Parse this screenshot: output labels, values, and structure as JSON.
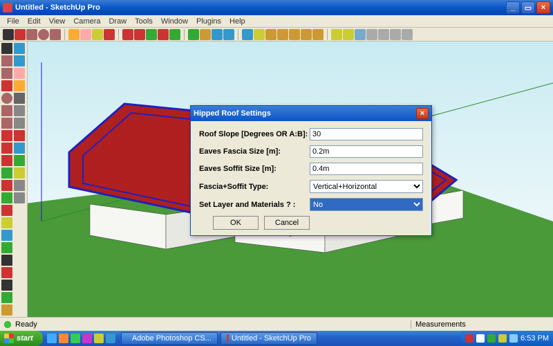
{
  "window": {
    "title": "Untitled - SketchUp Pro"
  },
  "menu": [
    "File",
    "Edit",
    "View",
    "Camera",
    "Draw",
    "Tools",
    "Window",
    "Plugins",
    "Help"
  ],
  "dialog": {
    "title": "Hipped Roof Settings",
    "fields": {
      "slope_label": "Roof Slope [Degrees OR A:B]:",
      "slope_value": "30",
      "fascia_label": "Eaves Fascia Size [m]:",
      "fascia_value": "0.2m",
      "soffit_label": "Eaves Soffit Size [m]:",
      "soffit_value": "0.4m",
      "type_label": "Fascia+Soffit Type:",
      "type_value": "Vertical+Horizontal",
      "layer_label": "Set Layer and Materials ? :",
      "layer_value": "No"
    },
    "ok": "OK",
    "cancel": "Cancel"
  },
  "status": {
    "ready": "Ready",
    "measurements_label": "Measurements"
  },
  "taskbar": {
    "start": "start",
    "items": [
      {
        "label": "Adobe Photoshop CS...",
        "color": "#2a4a8a"
      },
      {
        "label": "Untitled - SketchUp Pro",
        "color": "#c04030"
      }
    ],
    "clock": "6:53 PM"
  },
  "colors": {
    "roof": "#b02020",
    "roof_edge": "#2020c0",
    "wall": "#f6f6f2",
    "ground": "#4a9a3a",
    "sky_top": "#c8ebf2"
  }
}
